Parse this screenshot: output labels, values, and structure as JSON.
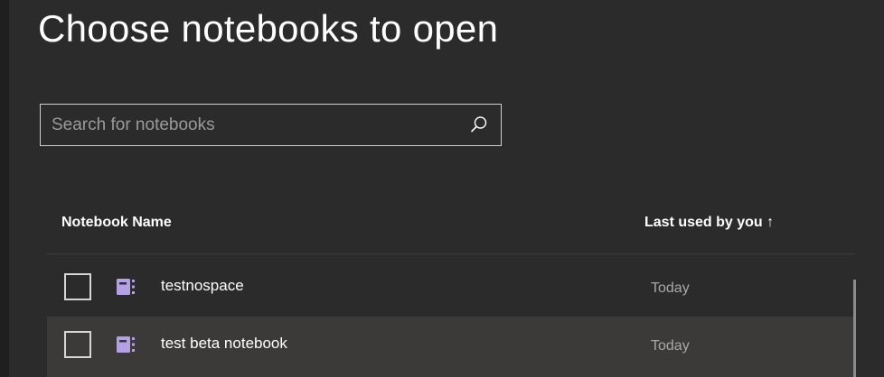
{
  "dialog": {
    "title": "Choose notebooks to open"
  },
  "search": {
    "placeholder": "Search for notebooks",
    "value": "",
    "icon": "search-icon"
  },
  "table": {
    "columns": {
      "name": "Notebook Name",
      "last_used": "Last used by you ↑"
    },
    "rows": [
      {
        "name": "testnospace",
        "last_used": "Today",
        "checked": false,
        "icon": "notebook-icon",
        "icon_color": "#b4a0e5"
      },
      {
        "name": "test beta notebook",
        "last_used": "Today",
        "checked": false,
        "icon": "notebook-icon",
        "icon_color": "#b4a0e5"
      }
    ]
  },
  "colors": {
    "background": "#2b2b2b",
    "selected_row": "#3b3a39",
    "notebook_accent": "#b4a0e5",
    "secondary_text": "#a8a8a8"
  }
}
